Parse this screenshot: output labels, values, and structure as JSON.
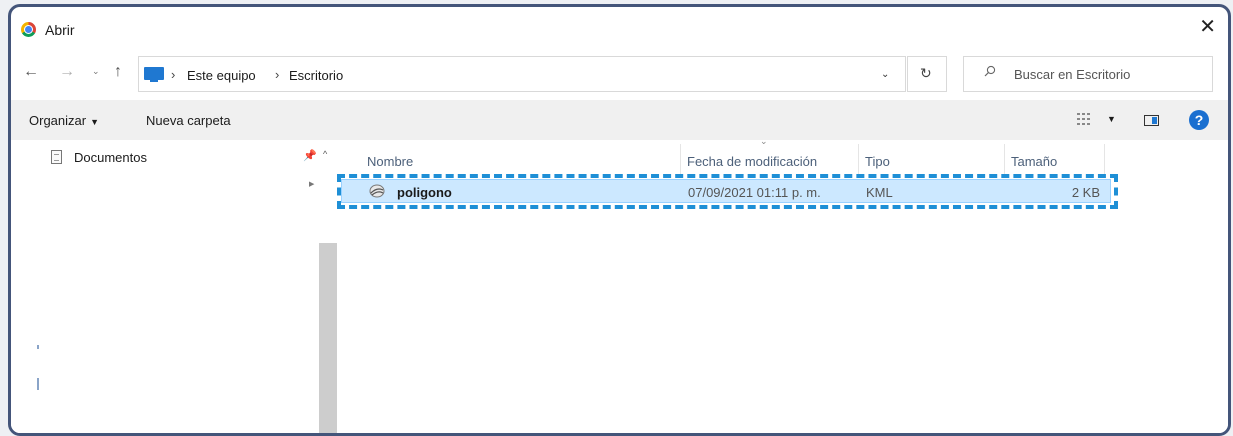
{
  "window": {
    "title": "Abrir"
  },
  "address": {
    "crumbs": [
      "Este equipo",
      "Escritorio"
    ],
    "search_placeholder": "Buscar en Escritorio"
  },
  "toolbar": {
    "organize_label": "Organizar",
    "new_folder_label": "Nueva carpeta"
  },
  "nav": {
    "items": [
      {
        "label": "Documentos"
      }
    ]
  },
  "columns": {
    "name": "Nombre",
    "modified": "Fecha de modificación",
    "type": "Tipo",
    "size": "Tamaño"
  },
  "files": [
    {
      "name": "poligono",
      "modified": "07/09/2021 01:11 p. m.",
      "type": "KML",
      "size": "2 KB",
      "selected": true
    }
  ],
  "colors": {
    "frame": "#44557a",
    "accent": "#1a6fd0",
    "selection": "#cce8ff",
    "highlight": "#1e8fd6"
  }
}
